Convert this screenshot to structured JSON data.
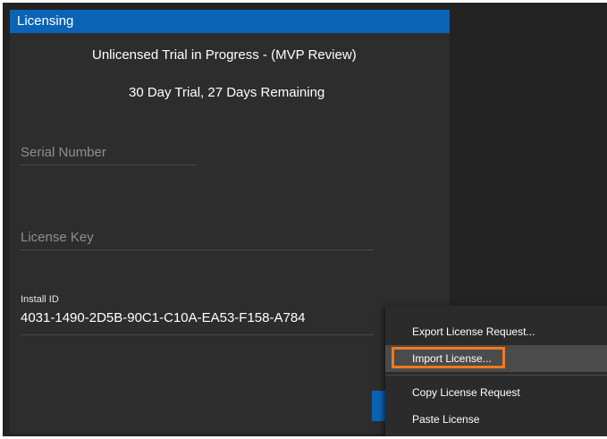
{
  "dialog": {
    "title": "Licensing",
    "trial_status": "Unlicensed Trial in Progress - (MVP Review)",
    "trial_days": "30 Day Trial, 27 Days Remaining",
    "serial_number": {
      "placeholder": "Serial Number",
      "value": ""
    },
    "license_key": {
      "placeholder": "License Key",
      "value": ""
    },
    "install_id": {
      "label": "Install ID",
      "value": "4031-1490-2D5B-90C1-C10A-EA53-F158-A784"
    }
  },
  "context_menu": {
    "items": [
      {
        "label": "Export License Request..."
      },
      {
        "label": "Import License..."
      },
      {
        "label": "Copy License Request"
      },
      {
        "label": "Paste License"
      }
    ],
    "highlighted_item": "Import License..."
  },
  "colors": {
    "title_bar": "#0b63b5",
    "dialog_bg": "#2d2d2d",
    "menu_bg": "#2b2b2b",
    "menu_hover": "#4b4b4b",
    "highlight": "#f0791f"
  }
}
